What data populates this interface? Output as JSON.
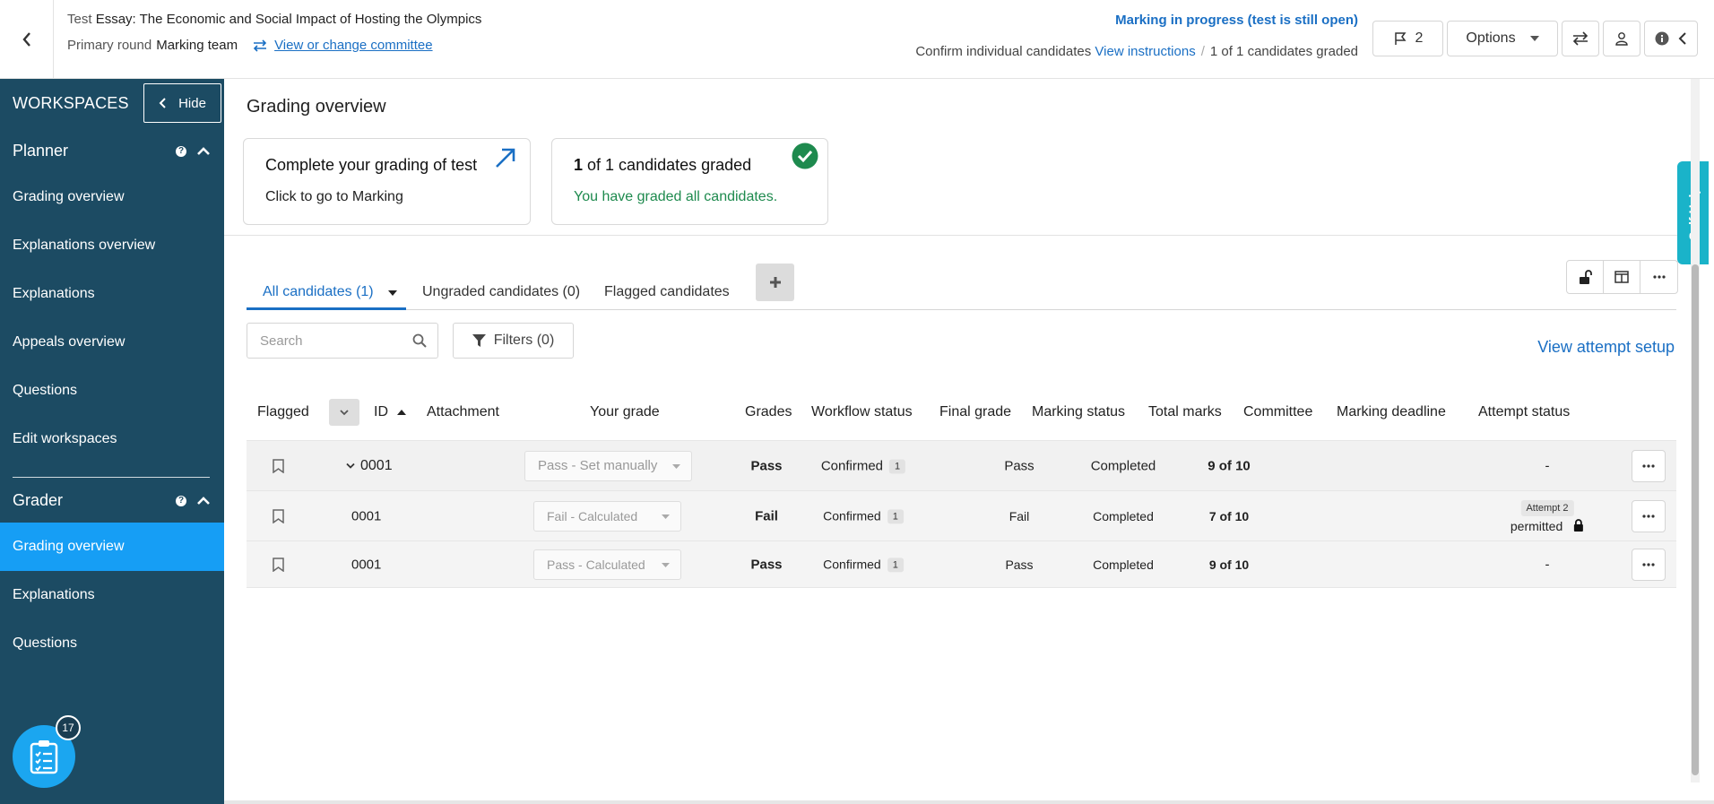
{
  "header": {
    "test_prefix": "Test",
    "test_title": "Essay: The Economic and Social Impact of Hosting the Olympics",
    "round_label": "Primary round",
    "team": "Marking team",
    "committee_link": "View or change committee",
    "status": "Marking in progress (test is still open)",
    "confirm_label": "Confirm individual candidates",
    "view_instructions": "View instructions",
    "separator": "/",
    "graded_summary": "1 of 1 candidates graded",
    "flag_count": "2",
    "options_label": "Options"
  },
  "sidebar": {
    "title": "WORKSPACES",
    "hide_label": "Hide",
    "planner": {
      "title": "Planner",
      "items": [
        {
          "label": "Grading overview"
        },
        {
          "label": "Explanations overview"
        },
        {
          "label": "Explanations"
        },
        {
          "label": "Appeals overview"
        },
        {
          "label": "Questions"
        },
        {
          "label": "Edit workspaces"
        }
      ]
    },
    "grader": {
      "title": "Grader",
      "items": [
        {
          "label": "Grading overview",
          "active": true
        },
        {
          "label": "Explanations"
        },
        {
          "label": "Questions"
        }
      ]
    },
    "fab_badge": "17",
    "help_glyph": "?"
  },
  "main": {
    "title": "Grading overview",
    "card_marking": {
      "title": "Complete your grading of test",
      "subtitle": "Click to go to Marking"
    },
    "card_graded": {
      "count": "1",
      "title_rest": "of 1 candidates graded",
      "subtitle": "You have graded all candidates."
    },
    "tabs": [
      {
        "label": "All candidates (1)",
        "active": true
      },
      {
        "label": "Ungraded candidates (0)"
      },
      {
        "label": "Flagged candidates"
      }
    ],
    "search_placeholder": "Search",
    "filters_label": "Filters (0)",
    "view_attempt_setup": "View attempt setup",
    "columns": {
      "flagged": "Flagged",
      "id": "ID",
      "attachment": "Attachment",
      "your_grade": "Your grade",
      "grades": "Grades",
      "workflow_status": "Workflow status",
      "final_grade": "Final grade",
      "marking_status": "Marking status",
      "total_marks": "Total marks",
      "committee": "Committee",
      "marking_deadline": "Marking deadline",
      "attempt_status": "Attempt status"
    },
    "rows": [
      {
        "id": "0001",
        "your_grade": "Pass - Set manually",
        "grades": "Pass",
        "workflow": "Confirmed",
        "workflow_count": "1",
        "final_grade": "Pass",
        "marking_status": "Completed",
        "total_marks": "9 of 10",
        "attempt_status": "-"
      },
      {
        "id": "0001",
        "your_grade": "Fail - Calculated",
        "grades": "Fail",
        "workflow": "Confirmed",
        "workflow_count": "1",
        "final_grade": "Fail",
        "marking_status": "Completed",
        "total_marks": "7 of 10",
        "attempt_badge": "Attempt 2",
        "attempt_status": "permitted"
      },
      {
        "id": "0001",
        "your_grade": "Pass - Calculated",
        "grades": "Pass",
        "workflow": "Confirmed",
        "workflow_count": "1",
        "final_grade": "Pass",
        "marking_status": "Completed",
        "total_marks": "9 of 10",
        "attempt_status": "-"
      }
    ]
  },
  "self_help_label": "Self Help",
  "colors": {
    "sidebar_bg": "#1c4b63",
    "active_item": "#169ef5",
    "link_blue": "#1a6fc4",
    "success_green": "#1e8a4e",
    "self_help": "#1ab3c9"
  }
}
